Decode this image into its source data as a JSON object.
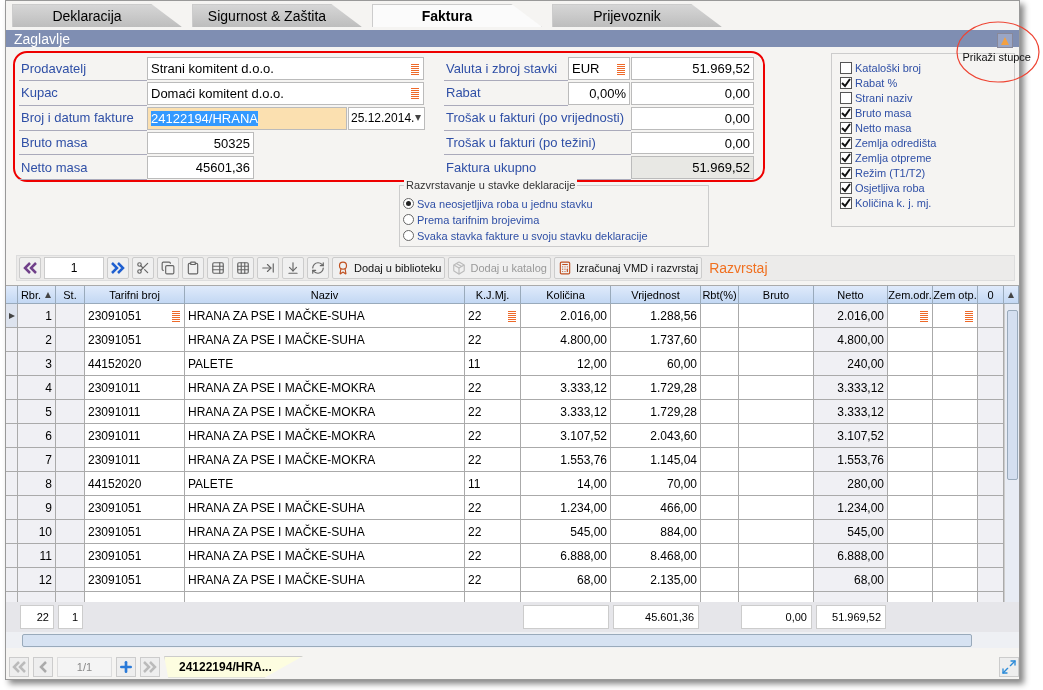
{
  "tabs": [
    {
      "label": "Deklaracija",
      "selected": false
    },
    {
      "label": "Sigurnost & Zaštita",
      "selected": false
    },
    {
      "label": "Faktura",
      "selected": true
    },
    {
      "label": "Prijevoznik",
      "selected": false
    }
  ],
  "section_title": "Zaglavlje",
  "form": {
    "seller": {
      "label": "Prodavatelj",
      "value": "Strani komitent d.o.o."
    },
    "buyer": {
      "label": "Kupac",
      "value": "Domaći komitent d.o.o."
    },
    "invoice": {
      "label": "Broj i datum fakture",
      "number": "24122194/HRANA",
      "date": "25.12.2014."
    },
    "gross": {
      "label": "Bruto masa",
      "value": "50325"
    },
    "net": {
      "label": "Netto masa",
      "value": "45601,36"
    },
    "currency": {
      "label": "Valuta i zbroj stavki",
      "code": "EUR",
      "total": "51.969,52"
    },
    "discount": {
      "label": "Rabat",
      "percent": "0,00%",
      "amount": "0,00"
    },
    "cost_value": {
      "label": "Trošak u fakturi (po vrijednosti)",
      "value": "0,00"
    },
    "cost_weight": {
      "label": "Trošak u fakturi (po težini)",
      "value": "0,00"
    },
    "total": {
      "label": "Faktura ukupno",
      "value": "51.969,52"
    }
  },
  "sorting": {
    "title": "Razvrstavanje u stavke deklaracije",
    "options": [
      {
        "label": "Sva neosjetljiva roba u jednu stavku",
        "selected": true
      },
      {
        "label": "Prema tarifnim brojevima",
        "selected": false
      },
      {
        "label": "Svaka stavka fakture u svoju stavku deklaracije",
        "selected": false
      }
    ]
  },
  "columns_toggle": {
    "label": "Prikaži stupce",
    "items": [
      {
        "label": "Kataloški broj",
        "checked": false
      },
      {
        "label": "Rabat %",
        "checked": true
      },
      {
        "label": "Strani naziv",
        "checked": false
      },
      {
        "label": "Bruto masa",
        "checked": true
      },
      {
        "label": "Netto masa",
        "checked": true
      },
      {
        "label": "Zemlja odredišta",
        "checked": true
      },
      {
        "label": "Zemlja otpreme",
        "checked": true
      },
      {
        "label": "Režim (T1/T2)",
        "checked": true
      },
      {
        "label": "Osjetljiva roba",
        "checked": true
      },
      {
        "label": "Količina k. j. mj.",
        "checked": true
      }
    ]
  },
  "toolbar": {
    "page": "1",
    "buttons": [
      {
        "label": "Dodaj u biblioteku",
        "disabled": false
      },
      {
        "label": "Dodaj u katalog",
        "disabled": true
      },
      {
        "label": "Izračunaj VMD i razvrstaj",
        "disabled": false
      }
    ],
    "link": "Razvrstaj"
  },
  "table": {
    "columns": [
      {
        "label": "Rbr.",
        "sorted": true
      },
      {
        "label": "St.",
        "sorted": false
      },
      {
        "label": "Tarifni broj",
        "sorted": false
      },
      {
        "label": "Naziv",
        "sorted": false
      },
      {
        "label": "K.J.Mj.",
        "sorted": false
      },
      {
        "label": "Količina",
        "sorted": false
      },
      {
        "label": "Vrijednost",
        "sorted": false
      },
      {
        "label": "Rbt(%)",
        "sorted": false
      },
      {
        "label": "Bruto",
        "sorted": false
      },
      {
        "label": "Netto",
        "sorted": false
      },
      {
        "label": "Zem.odr.",
        "sorted": false
      },
      {
        "label": "Zem otp.",
        "sorted": false
      },
      {
        "label": "0",
        "sorted": false
      }
    ],
    "rows": [
      {
        "current": true,
        "rbr": "1",
        "tariff": "23091051",
        "name": "HRANA ZA PSE I MAČKE-SUHA",
        "unit": "22",
        "qty": "2.016,00",
        "value": "1.288,56",
        "net": "2.016,00"
      },
      {
        "current": false,
        "rbr": "2",
        "tariff": "23091051",
        "name": "HRANA ZA PSE I MAČKE-SUHA",
        "unit": "22",
        "qty": "4.800,00",
        "value": "1.737,60",
        "net": "4.800,00"
      },
      {
        "current": false,
        "rbr": "3",
        "tariff": "44152020",
        "name": "PALETE",
        "unit": "11",
        "qty": "12,00",
        "value": "60,00",
        "net": "240,00"
      },
      {
        "current": false,
        "rbr": "4",
        "tariff": "23091011",
        "name": "HRANA ZA PSE I MAČKE-MOKRA",
        "unit": "22",
        "qty": "3.333,12",
        "value": "1.729,28",
        "net": "3.333,12"
      },
      {
        "current": false,
        "rbr": "5",
        "tariff": "23091011",
        "name": "HRANA ZA PSE I MAČKE-MOKRA",
        "unit": "22",
        "qty": "3.333,12",
        "value": "1.729,28",
        "net": "3.333,12"
      },
      {
        "current": false,
        "rbr": "6",
        "tariff": "23091011",
        "name": "HRANA ZA PSE I MAČKE-MOKRA",
        "unit": "22",
        "qty": "3.107,52",
        "value": "2.043,60",
        "net": "3.107,52"
      },
      {
        "current": false,
        "rbr": "7",
        "tariff": "23091011",
        "name": "HRANA ZA PSE I MAČKE-MOKRA",
        "unit": "22",
        "qty": "1.553,76",
        "value": "1.145,04",
        "net": "1.553,76"
      },
      {
        "current": false,
        "rbr": "8",
        "tariff": "44152020",
        "name": "PALETE",
        "unit": "11",
        "qty": "14,00",
        "value": "70,00",
        "net": "280,00"
      },
      {
        "current": false,
        "rbr": "9",
        "tariff": "23091051",
        "name": "HRANA ZA PSE I MAČKE-SUHA",
        "unit": "22",
        "qty": "1.234,00",
        "value": "466,00",
        "net": "1.234,00"
      },
      {
        "current": false,
        "rbr": "10",
        "tariff": "23091051",
        "name": "HRANA ZA PSE I MAČKE-SUHA",
        "unit": "22",
        "qty": "545,00",
        "value": "884,00",
        "net": "545,00"
      },
      {
        "current": false,
        "rbr": "11",
        "tariff": "23091051",
        "name": "HRANA ZA PSE I MAČKE-SUHA",
        "unit": "22",
        "qty": "6.888,00",
        "value": "8.468,00",
        "net": "6.888,00"
      },
      {
        "current": false,
        "rbr": "12",
        "tariff": "23091051",
        "name": "HRANA ZA PSE I MAČKE-SUHA",
        "unit": "22",
        "qty": "68,00",
        "value": "2.135,00",
        "net": "68,00"
      }
    ],
    "footer": {
      "count": "22",
      "st": "1",
      "value": "45.601,36",
      "gross": "0,00",
      "net": "51.969,52"
    }
  },
  "pager": {
    "page": "1/1",
    "document_tab": "24122194/HRA..."
  }
}
